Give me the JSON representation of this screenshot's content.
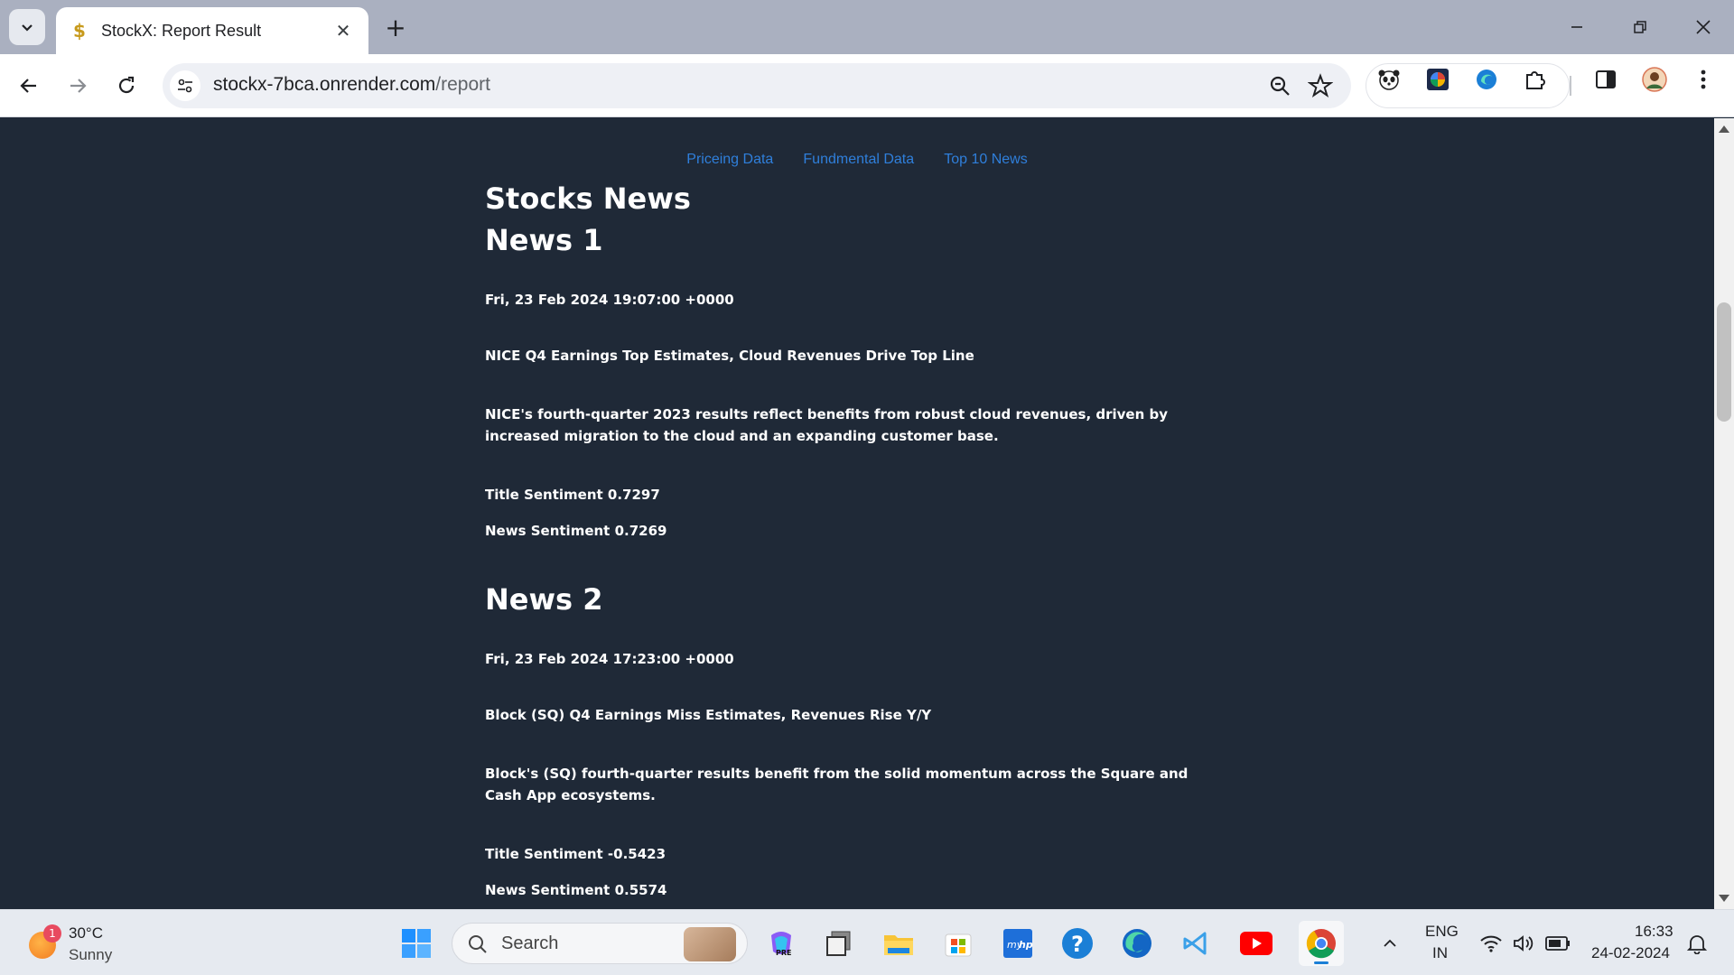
{
  "browser": {
    "tab_title": "StockX: Report Result",
    "url_host": "stockx-7bca.onrender.com",
    "url_path": "/report"
  },
  "nav": {
    "links": [
      "Priceing Data",
      "Fundmental Data",
      "Top 10 News"
    ]
  },
  "page": {
    "heading": "Stocks News",
    "news": [
      {
        "label": "News 1",
        "date": "Fri, 23 Feb 2024 19:07:00 +0000",
        "headline": "NICE Q4 Earnings Top Estimates, Cloud Revenues Drive Top Line",
        "description": "NICE's fourth-quarter 2023 results reflect benefits from robust cloud revenues, driven by increased migration to the cloud and an expanding customer base.",
        "title_sentiment": "Title Sentiment 0.7297",
        "news_sentiment": "News Sentiment 0.7269"
      },
      {
        "label": "News 2",
        "date": "Fri, 23 Feb 2024 17:23:00 +0000",
        "headline": "Block (SQ) Q4 Earnings Miss Estimates, Revenues Rise Y/Y",
        "description": "Block's (SQ) fourth-quarter results benefit from the solid momentum across the Square and Cash App ecosystems.",
        "title_sentiment": "Title Sentiment -0.5423",
        "news_sentiment": "News Sentiment 0.5574"
      }
    ]
  },
  "taskbar": {
    "weather_temp": "30°C",
    "weather_cond": "Sunny",
    "weather_badge": "1",
    "search_label": "Search",
    "lang_top": "ENG",
    "lang_bottom": "IN",
    "time": "16:33",
    "date": "24-02-2024"
  },
  "colors": {
    "page_bg": "#1f2937",
    "link": "#2f7fdb",
    "text": "#ffffff"
  }
}
